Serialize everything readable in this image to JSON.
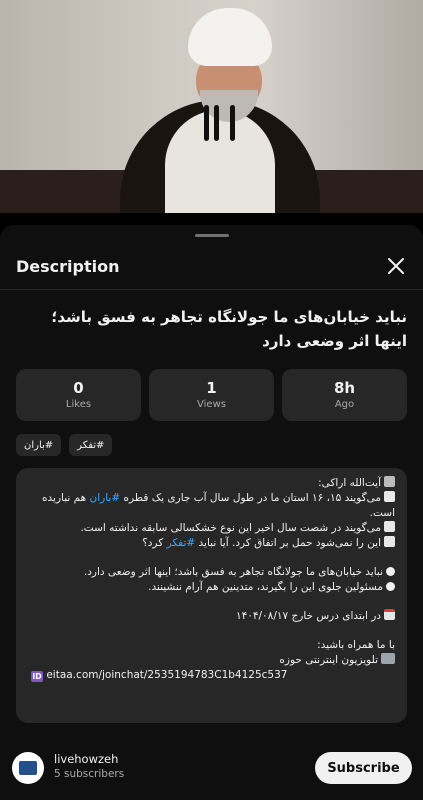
{
  "sheet": {
    "title": "Description"
  },
  "video_title": "نباید خیابان‌های ما جولانگاه تجاهر به فسق باشد؛ اینها اثر وضعی دارد",
  "stats": [
    {
      "value": "0",
      "label": "Likes"
    },
    {
      "value": "1",
      "label": "Views"
    },
    {
      "value": "8h",
      "label": "Ago"
    }
  ],
  "tags": [
    "#تفکر",
    "#باران"
  ],
  "description": {
    "author": "آیت‌الله اراکی:",
    "line1_a": "می‌گویند ۱۵، ۱۶ استان ما در طول سال آب جاری یک قطره ",
    "line1_tag": "#باران",
    "line1_b": " هم نباریده است.",
    "line2": "می‌گویند در شصت سال اخیر این نوع خشکسالی سابقه نداشته است.",
    "line3_a": "این را نمی‌شود حمل بر اتفاق کرد. آیا نباید ",
    "line3_tag": "#تفکر",
    "line3_b": " کرد؟",
    "line4": "نباید خیابان‌های ما جولانگاه تجاهر به فسق باشد؛ اینها اثر وضعی دارد.",
    "line5": "مسئولین جلوی این را بگیرند، متدینین هم آرام ننشینند.",
    "date_line": "در ابتدای درس خارج ۱۴۰۴/۰۸/۱۷",
    "join": "با ما همراه باشید:",
    "channel_label": "تلویزیون اینترنتی حوزه",
    "link": "eitaa.com/joinchat/2535194783C1b4125c537"
  },
  "channel": {
    "name": "livehowzeh",
    "subscribers": "5 subscribers"
  },
  "subscribe_label": "Subscribe",
  "icons": {
    "close": "close-icon",
    "calendar": "calendar-icon",
    "tv": "tv-icon",
    "id": "id-icon"
  }
}
